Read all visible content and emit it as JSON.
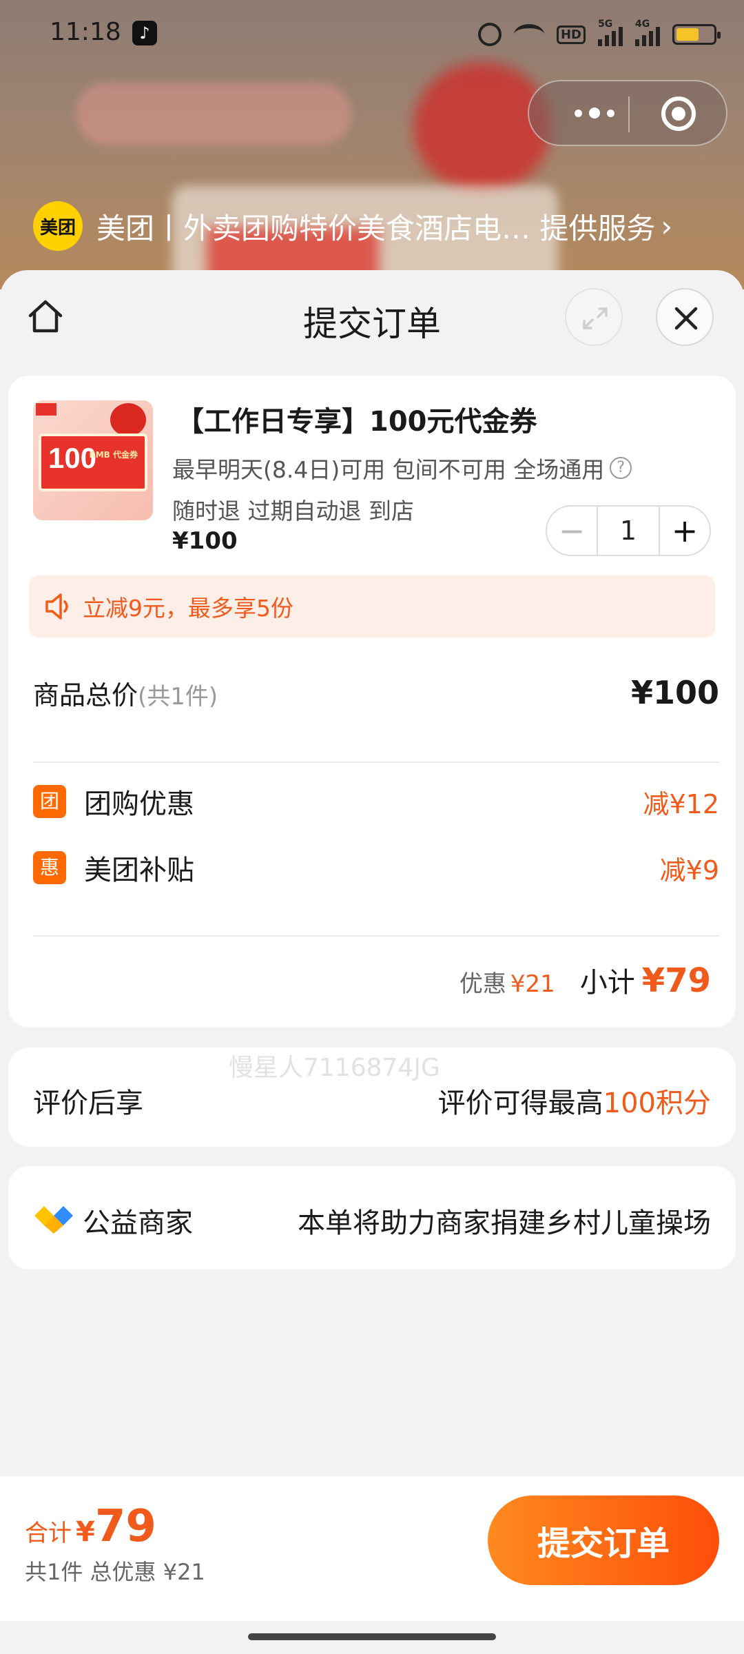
{
  "status_bar": {
    "time": "11:18",
    "signal1_label": "5G",
    "signal2_label": "4G",
    "hd_label": "HD"
  },
  "provider": {
    "logo_text": "美团",
    "text": "美团丨外卖团购特价美食酒店电… 提供服务",
    "chevron": "›"
  },
  "header": {
    "title": "提交订单"
  },
  "product": {
    "title": "【工作日专享】100元代金券",
    "info_line1": "最早明天(8.4日)可用 包间不可用 全场通用",
    "info_line2": "随时退 过期自动退 到店",
    "price": "¥100",
    "quantity": "1",
    "image_big": "100",
    "image_small": "RMB 代金券"
  },
  "promo": {
    "text": "立减9元，最多享5份"
  },
  "total": {
    "label": "商品总价",
    "count": "(共1件)",
    "value": "¥100"
  },
  "discounts": [
    {
      "badge": "团",
      "name": "团购优惠",
      "value": "减¥12"
    },
    {
      "badge": "惠",
      "name": "美团补贴",
      "value": "减¥9"
    }
  ],
  "watermark": "慢星人7116874JG",
  "subtotal": {
    "discount_label": "优惠",
    "discount_value": "¥21",
    "label": "小计",
    "value": "¥79"
  },
  "review": {
    "left": "评价后享",
    "right_prefix": "评价可得最高",
    "right_highlight": "100积分"
  },
  "charity": {
    "left": "公益商家",
    "right": "本单将助力商家捐建乡村儿童操场"
  },
  "bottom": {
    "total_label": "合计",
    "total_currency": "¥",
    "total_value": "79",
    "summary": "共1件 总优惠 ¥21",
    "submit_label": "提交订单"
  },
  "colors": {
    "accent": "#f05a1a",
    "button_gradient_start": "#ff8a1f",
    "button_gradient_end": "#ff4e0a",
    "logo_yellow": "#ffd100"
  }
}
